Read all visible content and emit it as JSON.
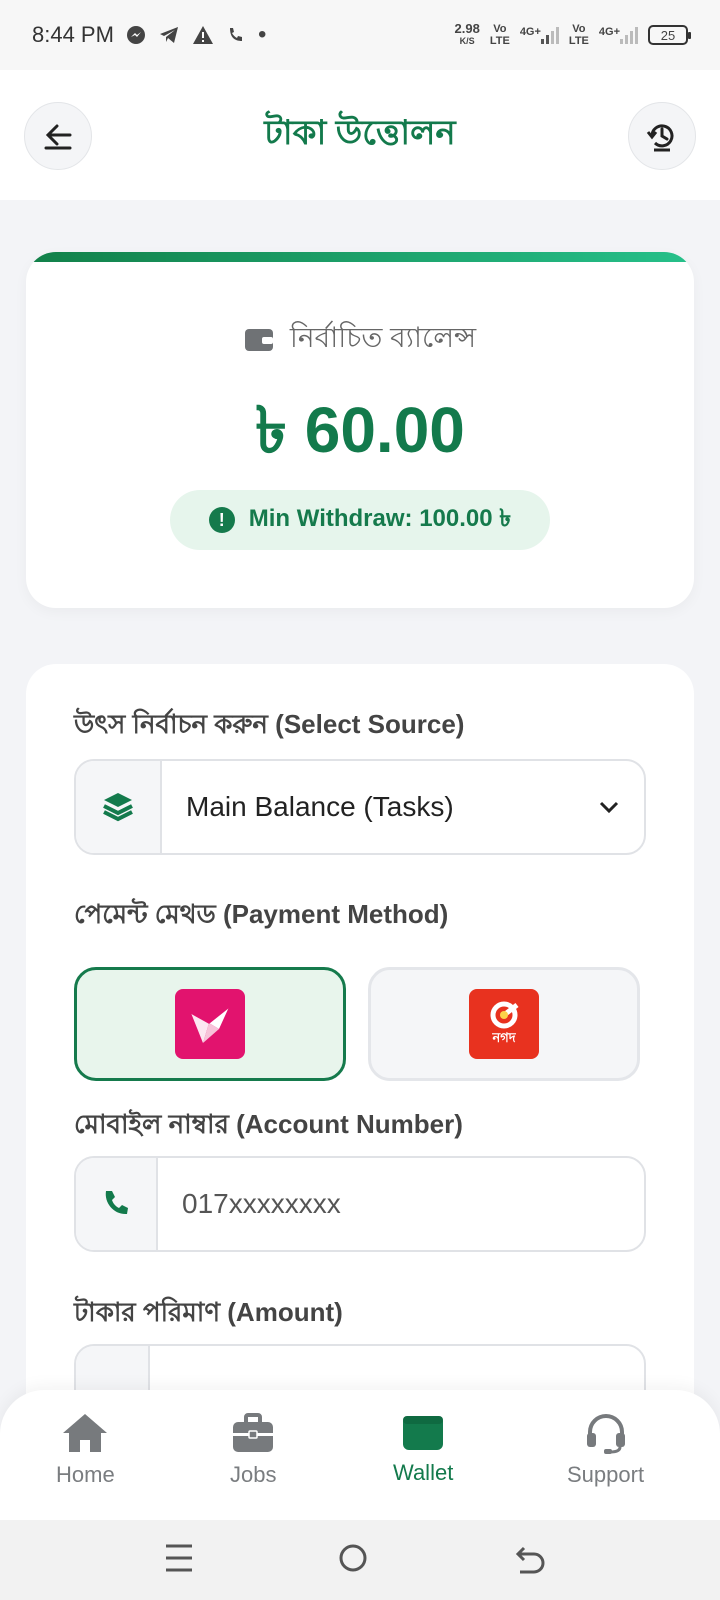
{
  "status_bar": {
    "time": "8:44 PM",
    "net_speed": "2.98",
    "net_unit": "K/S",
    "sim1": "Vo\nLTE",
    "sim1_type": "4G+",
    "sim2_type": "4G+",
    "battery": "25"
  },
  "header": {
    "title": "টাকা উত্তোলন"
  },
  "balance": {
    "label": "নির্বাচিত ব্যালেন্স",
    "amount": "৳ 60.00",
    "min_withdraw": "Min Withdraw: 100.00 ৳"
  },
  "form": {
    "source_label": "উৎস নির্বাচন করুন (Select Source)",
    "source_value": "Main Balance (Tasks)",
    "method_label": "পেমেন্ট মেথড (Payment Method)",
    "methods": [
      {
        "name": "bkash",
        "selected": true
      },
      {
        "name": "nagad",
        "selected": false,
        "logo_text": "নগদ"
      }
    ],
    "account_label": "মোবাইল নাম্বার (Account Number)",
    "account_placeholder": "017xxxxxxxx",
    "amount_label": "টাকার পরিমাণ (Amount)"
  },
  "bottom_nav": {
    "items": [
      {
        "label": "Home",
        "icon": "home-icon"
      },
      {
        "label": "Jobs",
        "icon": "briefcase-icon"
      },
      {
        "label": "Wallet",
        "icon": "wallet-icon",
        "active": true
      },
      {
        "label": "Support",
        "icon": "headset-icon"
      }
    ]
  },
  "colors": {
    "accent": "#137a4c",
    "bkash": "#e2136e",
    "nagad": "#e8321f"
  }
}
